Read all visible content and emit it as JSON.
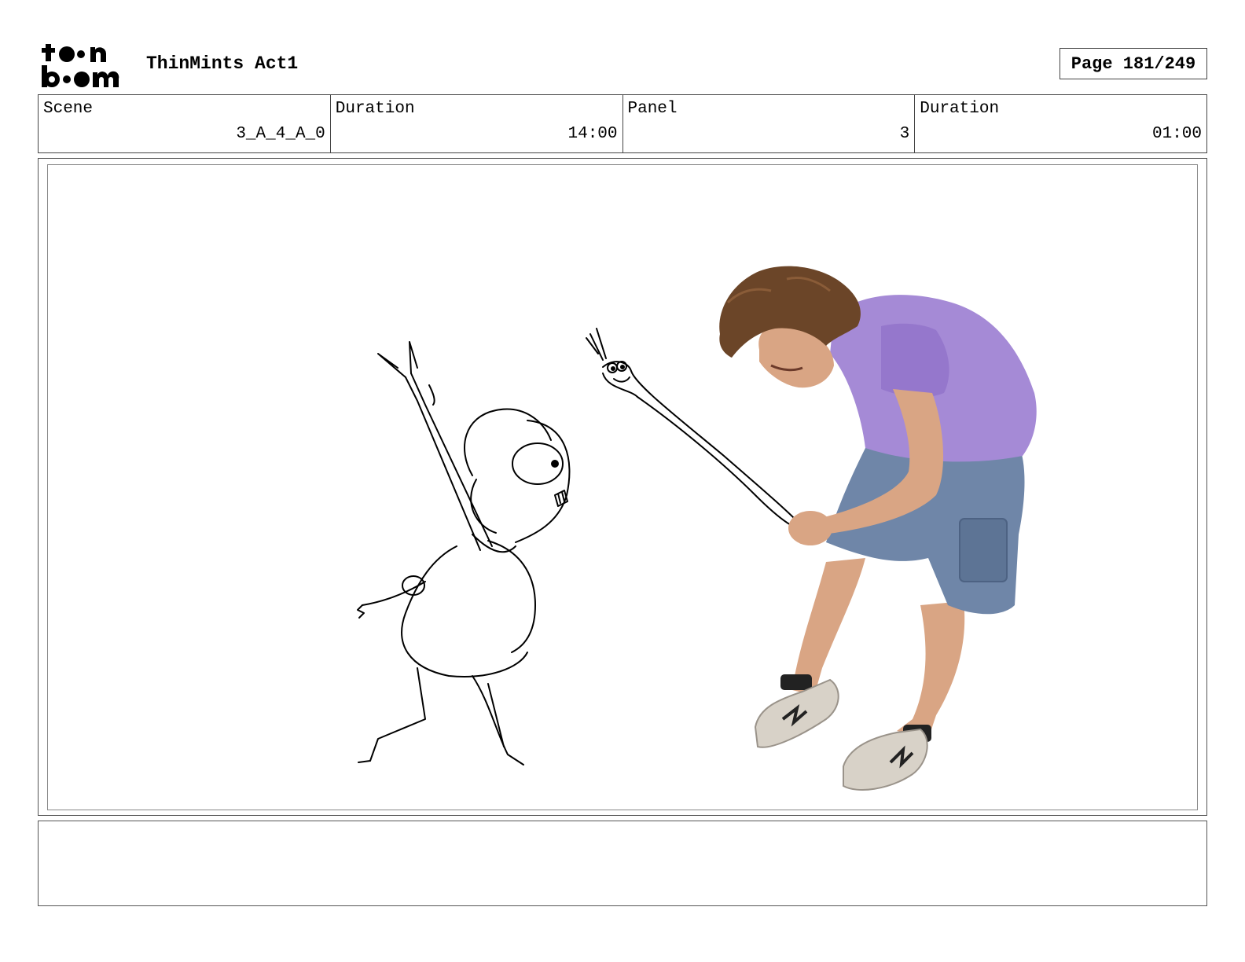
{
  "header": {
    "logo_lines": [
      "toon",
      "boom"
    ],
    "project_title": "ThinMints Act1",
    "page_label": "Page 181/249"
  },
  "info": {
    "scene_label": "Scene",
    "scene_value": "3_A_4_A_0",
    "scene_duration_label": "Duration",
    "scene_duration_value": "14:00",
    "panel_label": "Panel",
    "panel_value": "3",
    "panel_duration_label": "Duration",
    "panel_duration_value": "01:00"
  },
  "panel": {
    "image_description_icons": [
      "sketch-character-icon",
      "sketch-worm-creature-icon",
      "photo-reference-person-icon"
    ],
    "colors": {
      "shirt": "#a58ad6",
      "shorts": "#6f86a8",
      "skin": "#d9a584",
      "hair": "#6b4528",
      "shoe": "#d8d2c8"
    }
  },
  "notes": {
    "text": ""
  }
}
